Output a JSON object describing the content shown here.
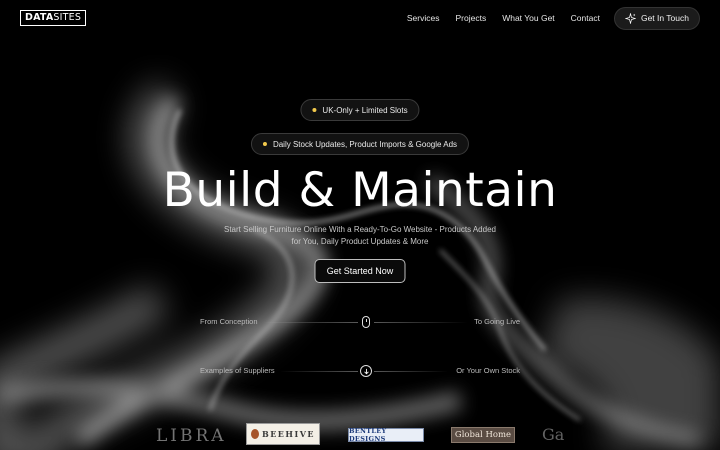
{
  "nav": {
    "logo": {
      "bold": "DATA",
      "light": "SITES"
    },
    "links": [
      "Services",
      "Projects",
      "What You Get",
      "Contact"
    ],
    "cta_label": "Get In Touch",
    "cta_icon": "sparkle-icon"
  },
  "hero": {
    "badges": [
      "UK-Only + Limited Slots",
      "Daily Stock Updates, Product Imports & Google Ads"
    ],
    "badge_dot_color": "#f2c94c",
    "title": "Build & Maintain",
    "subtitle": "Start Selling Furniture Online With a Ready-To-Go Website - Products Added for You, Daily Product Updates & More",
    "button_label": "Get Started Now"
  },
  "timeline": [
    {
      "left": "From Conception",
      "right": "To Going Live",
      "icon": "mouse-scroll-icon"
    },
    {
      "left": "Examples of Suppliers",
      "right": "Or Your Own Stock",
      "icon": "arrow-down-circle-icon"
    }
  ],
  "suppliers": {
    "libra": "LIBRA",
    "beehive": "BEEHIVE",
    "bentley": "BENTLEY DESIGNS",
    "global_home": "Global Home",
    "partial": "Ga"
  }
}
